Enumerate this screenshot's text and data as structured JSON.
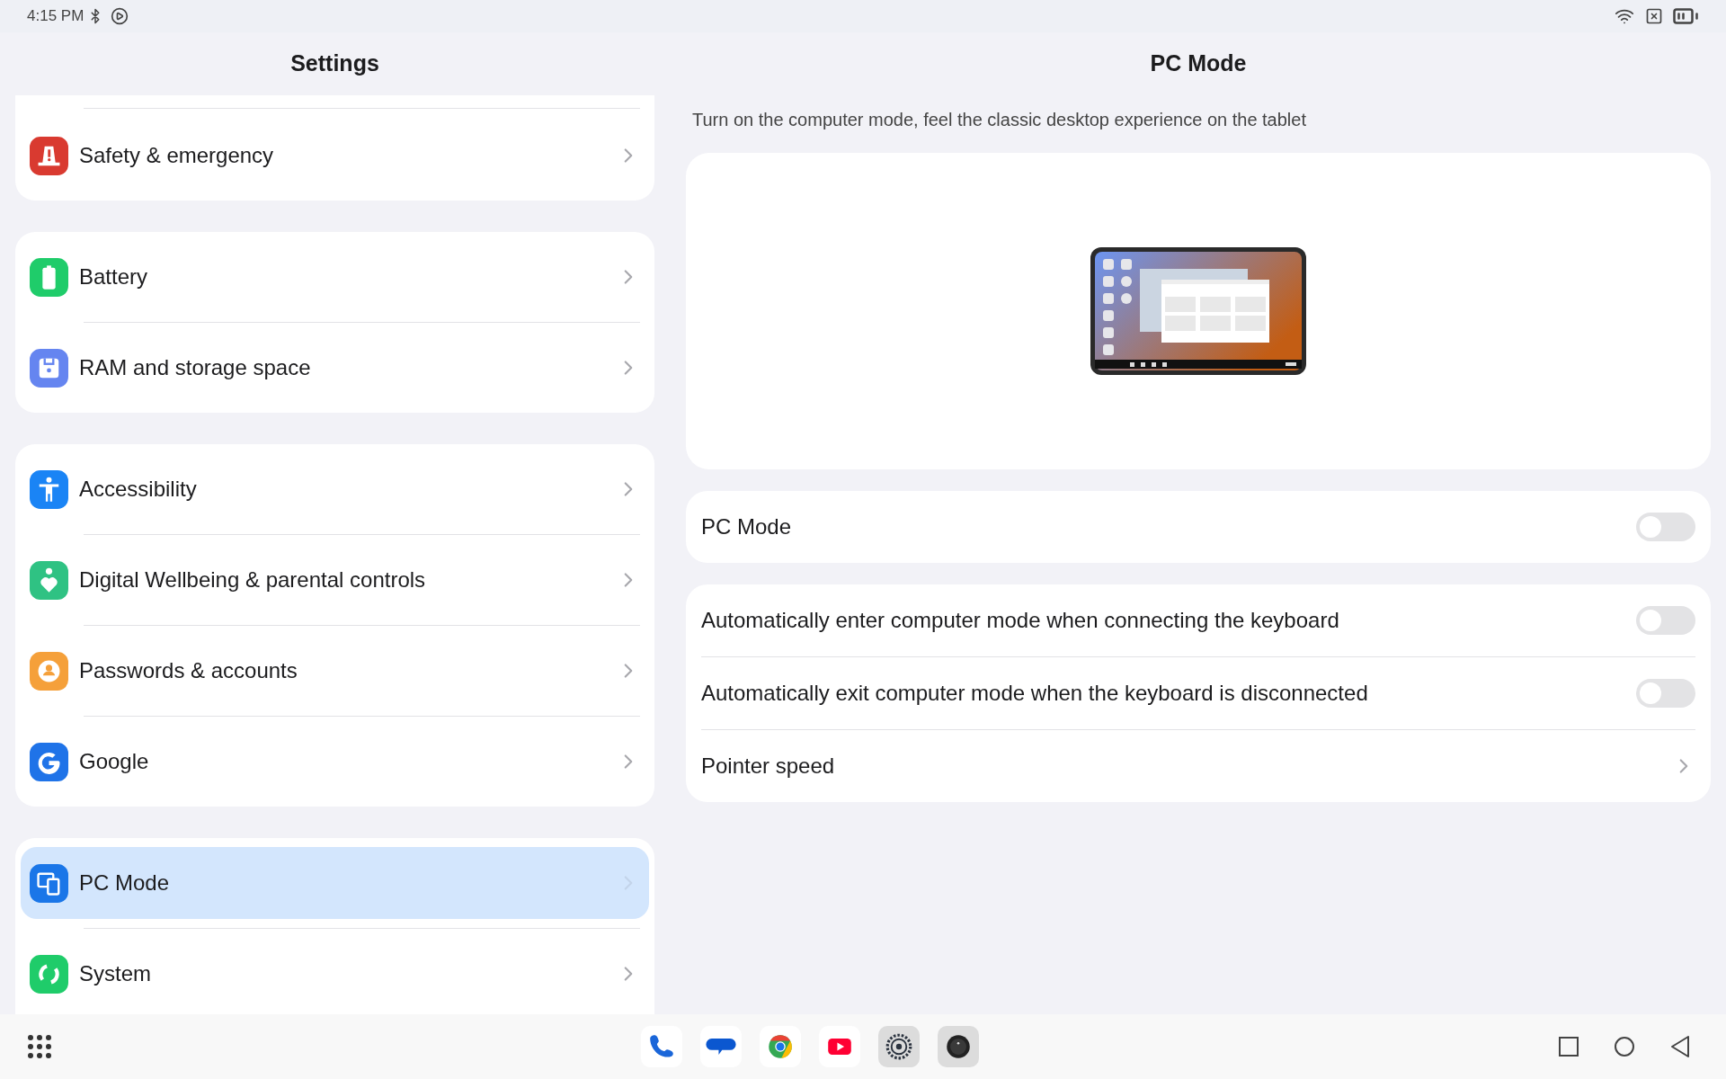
{
  "status_bar": {
    "time": "4:15 PM"
  },
  "sidebar": {
    "title": "Settings",
    "groups": [
      {
        "items": [
          {
            "label": "Safety & emergency",
            "kind": "safety",
            "selected": false
          }
        ]
      },
      {
        "items": [
          {
            "label": "Battery",
            "kind": "battery",
            "selected": false
          },
          {
            "label": "RAM and storage space",
            "kind": "storage",
            "selected": false
          }
        ]
      },
      {
        "items": [
          {
            "label": "Accessibility",
            "kind": "accessibility",
            "selected": false
          },
          {
            "label": "Digital Wellbeing & parental controls",
            "kind": "wellbeing",
            "selected": false
          },
          {
            "label": "Passwords & accounts",
            "kind": "accounts",
            "selected": false
          },
          {
            "label": "Google",
            "kind": "google",
            "selected": false
          }
        ]
      },
      {
        "items": [
          {
            "label": "PC Mode",
            "kind": "pcmode",
            "selected": true
          },
          {
            "label": "System",
            "kind": "system",
            "selected": false
          }
        ]
      }
    ]
  },
  "page": {
    "title": "PC Mode",
    "description": "Turn on the computer mode, feel the classic desktop experience on the tablet",
    "cards": [
      {
        "rows": [
          {
            "kind": "toggle",
            "label": "PC Mode",
            "on": false
          }
        ]
      },
      {
        "rows": [
          {
            "kind": "toggle",
            "label": "Automatically enter computer mode when connecting the keyboard",
            "on": false
          },
          {
            "kind": "toggle",
            "label": "Automatically exit computer mode when the keyboard is disconnected",
            "on": false
          },
          {
            "kind": "link",
            "label": "Pointer speed"
          }
        ]
      }
    ]
  },
  "taskbar": {
    "apps": [
      {
        "kind": "phone"
      },
      {
        "kind": "messages"
      },
      {
        "kind": "browser"
      },
      {
        "kind": "video"
      },
      {
        "kind": "settings"
      },
      {
        "kind": "camera"
      }
    ]
  }
}
